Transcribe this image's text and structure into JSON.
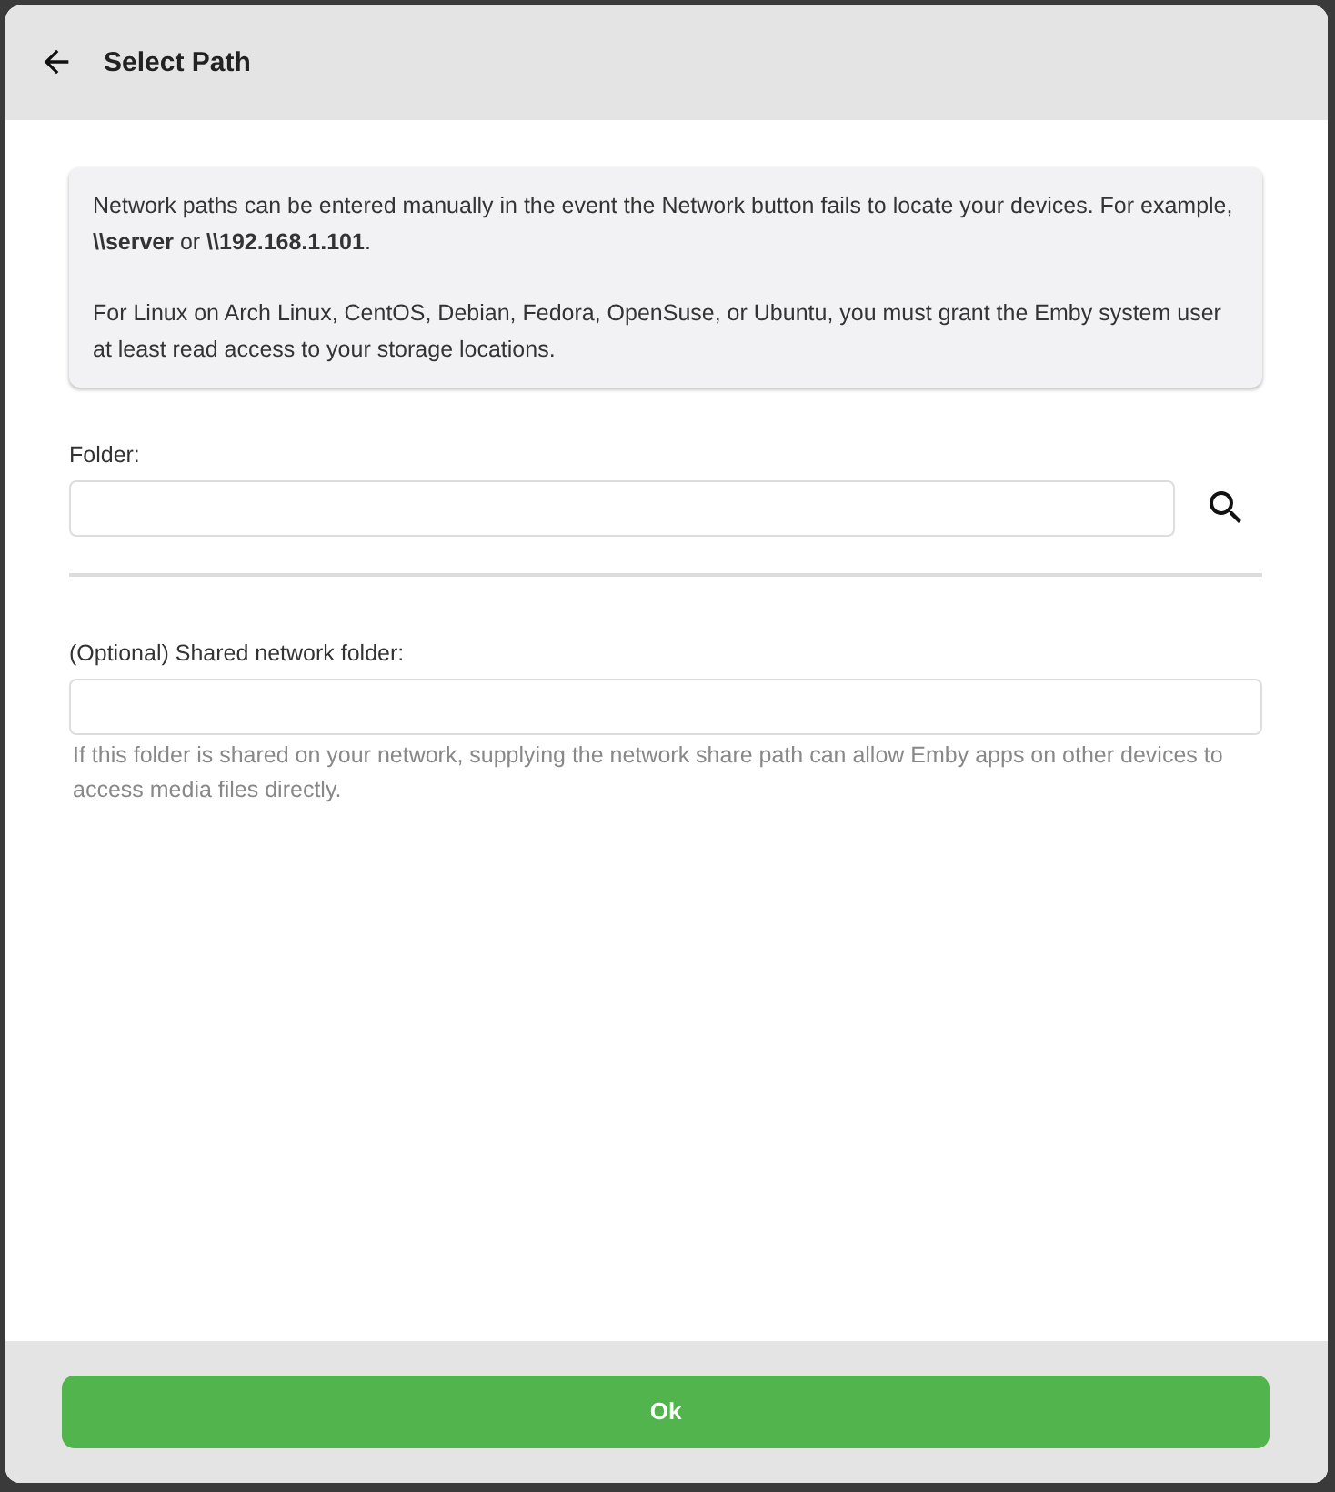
{
  "dialog": {
    "title": "Select Path"
  },
  "info": [
    "Network paths can be entered manually in the event the Network button fails to locate your devices. For example, **\\\\server** or **\\\\192.168.1.101**.",
    "For Linux on Arch Linux, CentOS, Debian, Fedora, OpenSuse, or Ubuntu, you must grant the Emby system user at least read access to your storage locations."
  ],
  "folder": {
    "label": "Folder:"
  },
  "shared_folder": {
    "label": "(Optional) Shared network folder:",
    "help": "If this folder is shared on your network, supplying the network share path can allow Emby apps on other devices to access media files directly."
  },
  "buttons": [
    "Ok"
  ]
}
